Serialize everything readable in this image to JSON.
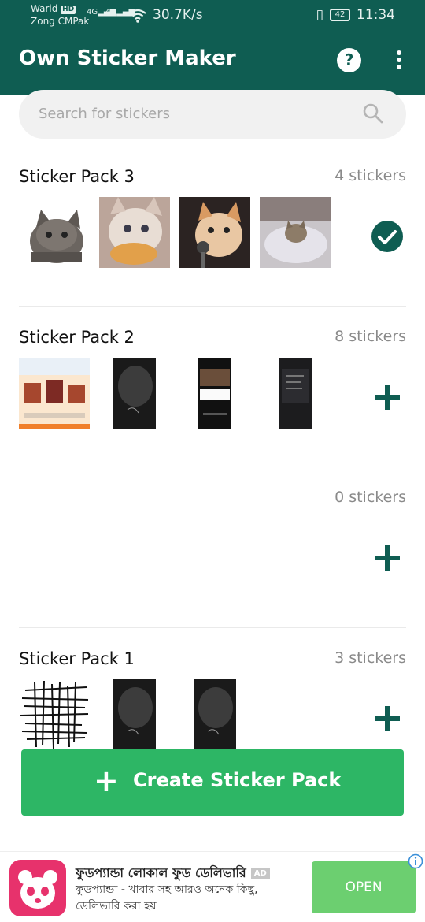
{
  "status_bar": {
    "carrier_1": "Warid",
    "hd_badge": "HD",
    "carrier_2": "Zong CMPak",
    "signal_1": "4G",
    "signal_2": "4G",
    "net_speed": "30.7K/s",
    "battery": "42",
    "time": "11:34"
  },
  "app_bar": {
    "title": "Own Sticker Maker",
    "help_label": "?"
  },
  "search": {
    "placeholder": "Search for stickers"
  },
  "packs": [
    {
      "title": "Sticker Pack 3",
      "count": "4 stickers",
      "action": "check-icon"
    },
    {
      "title": "Sticker Pack 2",
      "count": "8 stickers",
      "action": "plus-icon"
    },
    {
      "title": "",
      "count": "0 stickers",
      "action": "plus-icon"
    },
    {
      "title": "Sticker Pack 1",
      "count": "3 stickers",
      "action": "plus-icon"
    }
  ],
  "create_button": {
    "plus": "+",
    "label": "Create Sticker Pack"
  },
  "ad": {
    "title": "ফুডপ্যান্ডা লোকাল ফুড ডেলিভারি",
    "badge": "AD",
    "description": "ফুডপ্যান্ডা - খাবার সহ আরও অনেক কিছু, ডেলিভারি করা হয়",
    "button": "OPEN"
  },
  "colors": {
    "primary": "#0f5d52",
    "accent": "#2db665",
    "ad_button": "#6ccf70",
    "ad_icon": "#e7326c"
  }
}
